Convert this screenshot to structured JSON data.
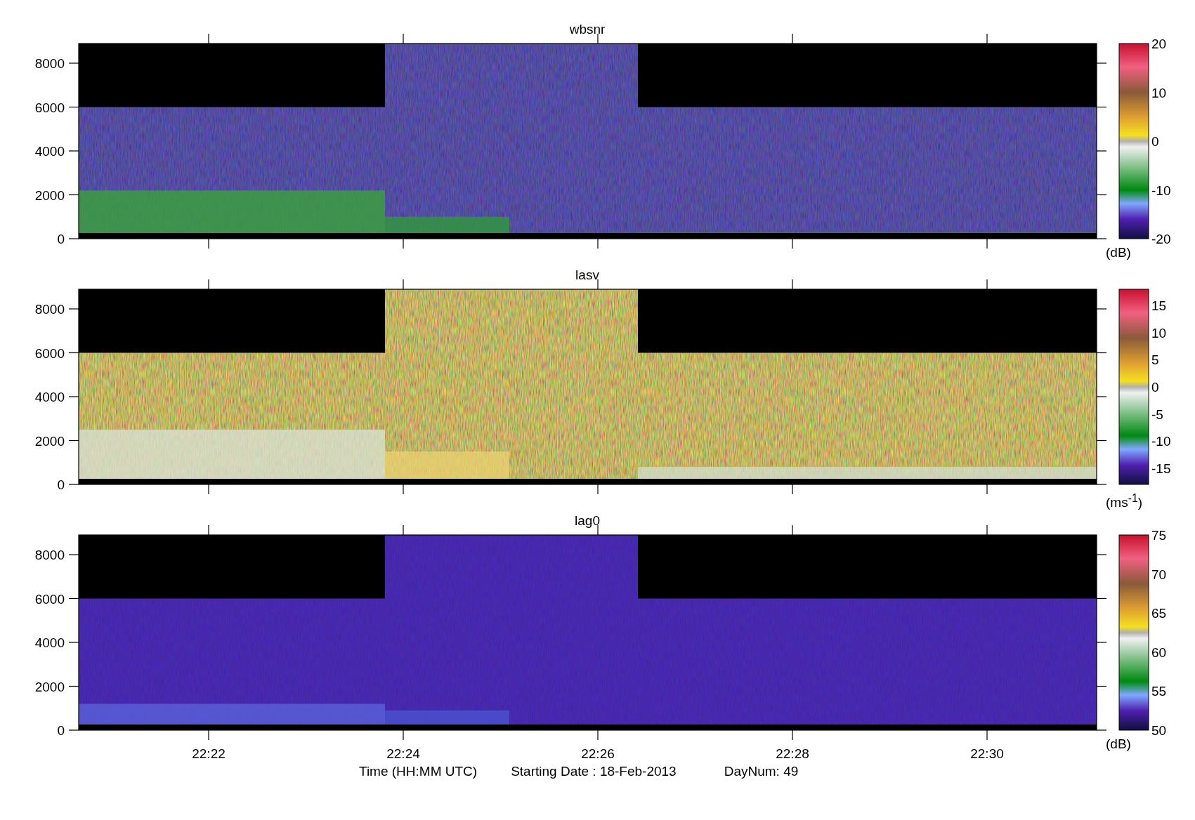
{
  "panels": [
    {
      "title": "wbsnr",
      "kind": "snr",
      "y_ticks": [
        "8000",
        "6000",
        "4000",
        "2000",
        "0"
      ],
      "colorbar": {
        "ticks": [
          "20",
          "10",
          "0",
          "-10",
          "-20"
        ],
        "unit": "(dB)"
      }
    },
    {
      "title": "lasv",
      "kind": "velocity",
      "y_ticks": [
        "8000",
        "6000",
        "4000",
        "2000",
        "0"
      ],
      "colorbar": {
        "ticks": [
          "15",
          "10",
          "5",
          "0",
          "-5",
          "-10",
          "-15"
        ],
        "unit": "(ms$^{-1}$)"
      }
    },
    {
      "title": "lag0",
      "kind": "power",
      "y_ticks": [
        "8000",
        "6000",
        "4000",
        "2000",
        "0"
      ],
      "colorbar": {
        "ticks": [
          "75",
          "70",
          "65",
          "60",
          "55",
          "50"
        ],
        "unit": "(dB)"
      }
    }
  ],
  "x_ticks": [
    "22:22",
    "22:24",
    "22:26",
    "22:28",
    "22:30"
  ],
  "footer": {
    "axis_label": "Time (HH:MM UTC)",
    "start_date": "Starting Date : 18-Feb-2013",
    "day_num": "DayNum: 49"
  }
}
